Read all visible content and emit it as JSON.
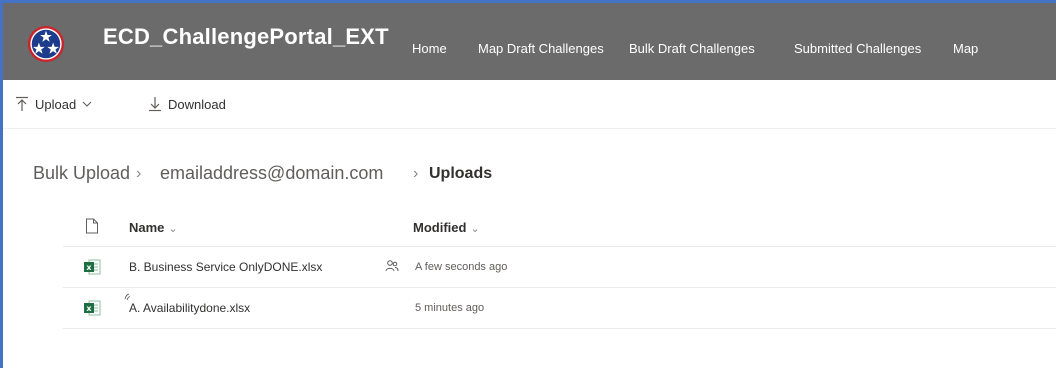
{
  "site": {
    "title": "ECD_ChallengePortal_EXT",
    "nav": [
      "Home",
      "Map Draft Challenges",
      "Bulk Draft Challenges",
      "Submitted Challenges",
      "Map"
    ]
  },
  "toolbar": {
    "upload_label": "Upload",
    "download_label": "Download"
  },
  "breadcrumb": {
    "items": [
      "Bulk Upload",
      "emailaddress@domain.com"
    ],
    "current": "Uploads"
  },
  "table": {
    "columns": {
      "name": "Name",
      "modified": "Modified"
    },
    "rows": [
      {
        "name": "B. Business Service OnlyDONE.xlsx",
        "modified": "A few seconds ago",
        "shared": true
      },
      {
        "name": "A. Availabilitydone.xlsx",
        "modified": "5 minutes ago",
        "shared": false
      }
    ]
  },
  "colors": {
    "header_bg": "#6b6b6b",
    "frame_accent": "#4472c4",
    "excel_green": "#1d6f42",
    "logo_red": "#cc2229",
    "logo_blue": "#1e3c8c"
  }
}
